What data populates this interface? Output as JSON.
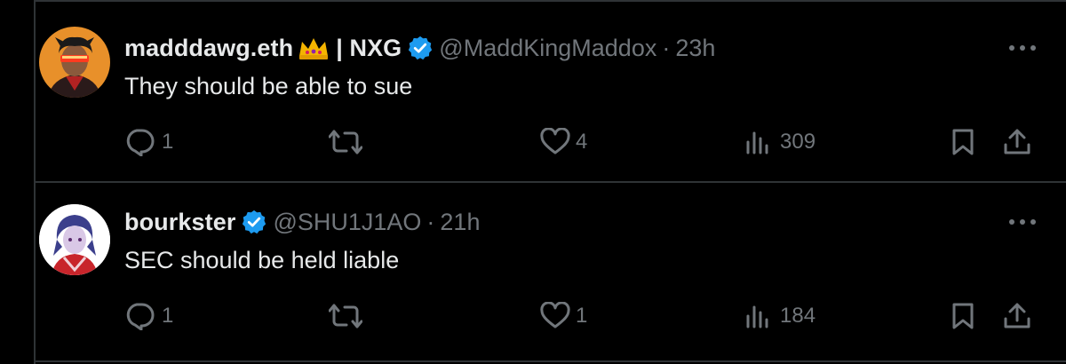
{
  "tweets": [
    {
      "display_name": "madddawg.eth",
      "name_suffix": "| NXG",
      "handle": "@MaddKingMaddox",
      "dot": "·",
      "time": "23h",
      "text": "They should be able to sue",
      "replies": "1",
      "retweets": "",
      "likes": "4",
      "views": "309"
    },
    {
      "display_name": "bourkster",
      "handle": "@SHU1J1AO",
      "dot": "·",
      "time": "21h",
      "text": "SEC should be held liable",
      "replies": "1",
      "retweets": "",
      "likes": "1",
      "views": "184"
    }
  ],
  "colors": {
    "background": "#000000",
    "text": "#e7e9ea",
    "muted": "#71767b",
    "verified": "#1d9bf0",
    "border": "#2f3336"
  }
}
